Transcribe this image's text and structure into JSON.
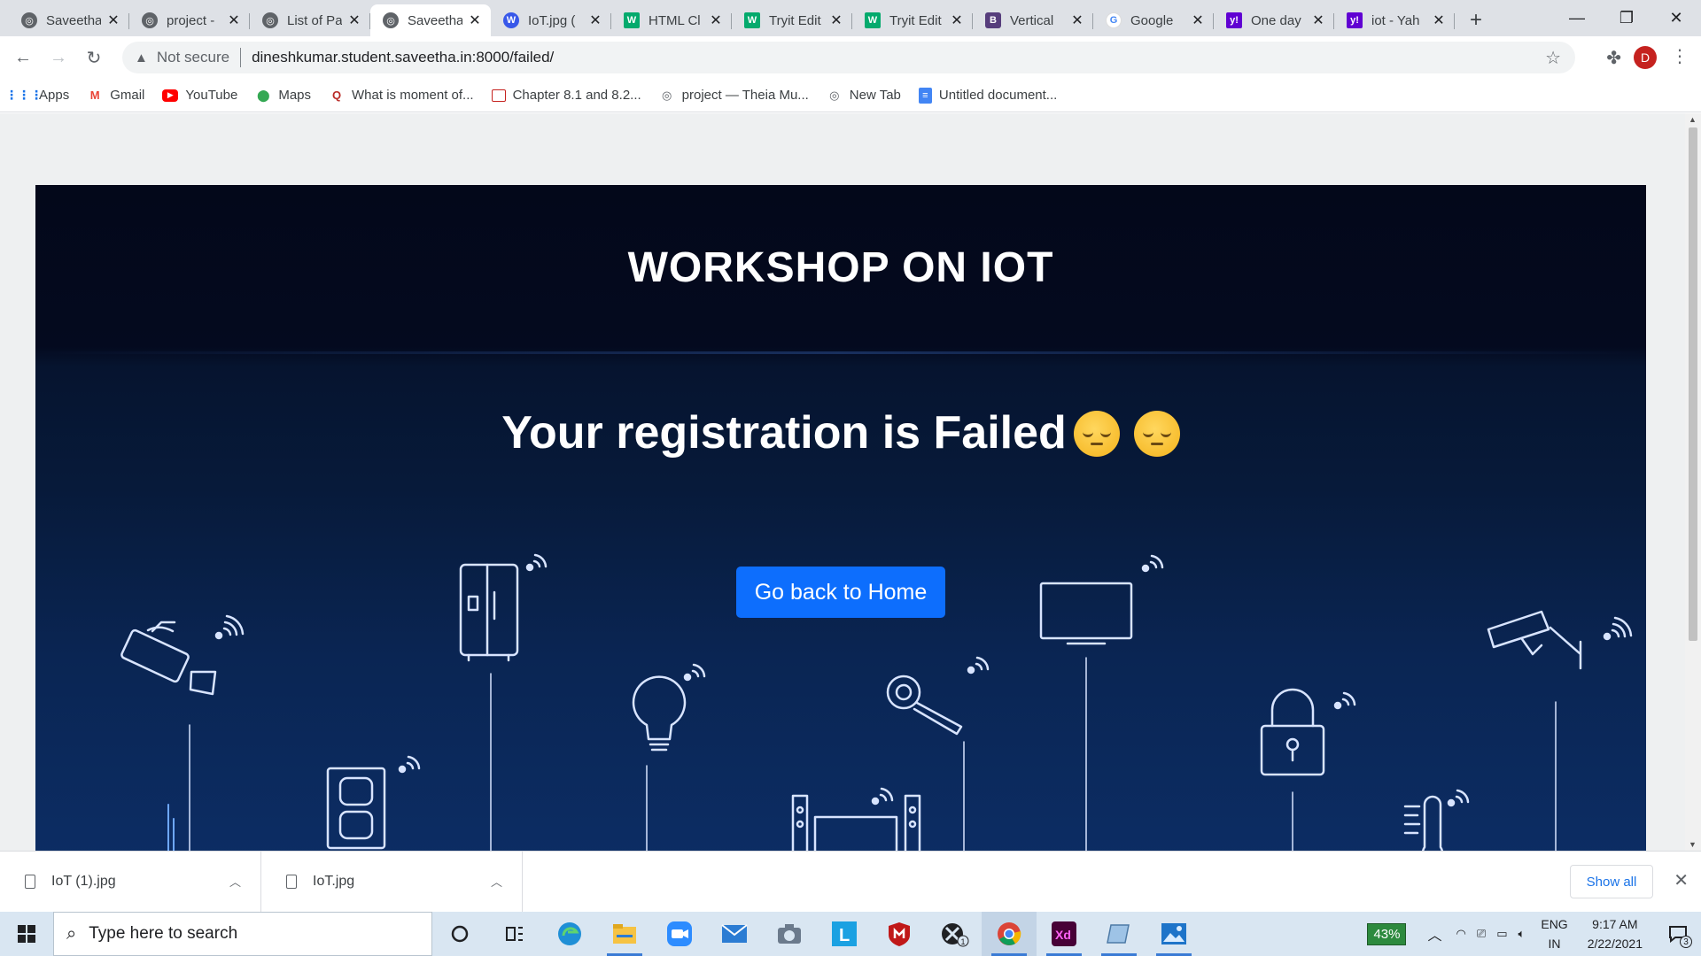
{
  "browser": {
    "tabs": [
      {
        "label": "Saveetha",
        "icon": "globe-icon",
        "active": false
      },
      {
        "label": "project - ",
        "icon": "globe-icon",
        "active": false
      },
      {
        "label": "List of Pa",
        "icon": "globe-icon",
        "active": false
      },
      {
        "label": "Saveetha",
        "icon": "globe-icon",
        "active": true
      },
      {
        "label": "IoT.jpg (",
        "icon": "wordpress-icon",
        "active": false
      },
      {
        "label": "HTML Cl",
        "icon": "w3-icon",
        "active": false
      },
      {
        "label": "Tryit Edit",
        "icon": "w3-icon",
        "active": false
      },
      {
        "label": "Tryit Edit",
        "icon": "w3-icon",
        "active": false
      },
      {
        "label": "Vertical",
        "icon": "bootstrap-icon",
        "active": false
      },
      {
        "label": "Google",
        "icon": "google-icon",
        "active": false
      },
      {
        "label": "One day",
        "icon": "yahoo-icon",
        "active": false
      },
      {
        "label": "iot - Yah",
        "icon": "yahoo-icon",
        "active": false
      }
    ],
    "security_label": "Not secure",
    "url": "dineshkumar.student.saveetha.in:8000/failed/",
    "profile_initial": "D",
    "bookmarks": [
      {
        "label": "Apps",
        "icon": "apps-grid-icon"
      },
      {
        "label": "Gmail",
        "icon": "gmail-icon"
      },
      {
        "label": "YouTube",
        "icon": "youtube-icon"
      },
      {
        "label": "Maps",
        "icon": "maps-pin-icon"
      },
      {
        "label": "What is moment of...",
        "icon": "quora-icon"
      },
      {
        "label": "Chapter 8.1 and 8.2...",
        "icon": "slides-icon"
      },
      {
        "label": "project — Theia Mu...",
        "icon": "globe-icon"
      },
      {
        "label": "New Tab",
        "icon": "globe-icon"
      },
      {
        "label": "Untitled document...",
        "icon": "docs-icon"
      }
    ]
  },
  "page": {
    "title": "WORKSHOP ON IOT",
    "message": "Your registration is Failed",
    "emoji_count": 2,
    "home_button": "Go back to Home"
  },
  "downloads": {
    "items": [
      {
        "name": "IoT (1).jpg"
      },
      {
        "name": "IoT.jpg"
      }
    ],
    "show_all": "Show all"
  },
  "taskbar": {
    "search_placeholder": "Type here to search",
    "battery": "43%",
    "language": "ENG",
    "region": "IN",
    "time": "9:17 AM",
    "date": "2/22/2021",
    "notification_count": "3",
    "xbox_badge": "1"
  },
  "colors": {
    "primary_button": "#0d6efd",
    "hero_dark": "#03081a",
    "hero_blue": "#0c2d64",
    "tab_strip": "#dee1e6"
  }
}
